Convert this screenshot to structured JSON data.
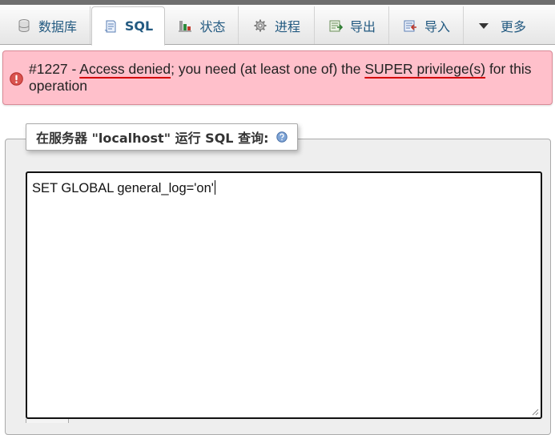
{
  "tabs": [
    {
      "label": "数据库",
      "icon": "database-icon",
      "active": false
    },
    {
      "label": "SQL",
      "icon": "sql-icon",
      "active": true
    },
    {
      "label": "状态",
      "icon": "status-chart-icon",
      "active": false
    },
    {
      "label": "进程",
      "icon": "gear-icon",
      "active": false
    },
    {
      "label": "导出",
      "icon": "export-icon",
      "active": false
    },
    {
      "label": "导入",
      "icon": "import-icon",
      "active": false
    },
    {
      "label": "更多",
      "icon": "chevron-down-icon",
      "active": false
    }
  ],
  "error": {
    "code": "#1227",
    "separator": " - ",
    "highlight_1": "Access denied",
    "text_1": "; you need (at least one of) the ",
    "highlight_2": "SUPER privilege(s)",
    "text_2": " for this operation",
    "icon": "error-icon"
  },
  "query_panel": {
    "legend": "在服务器 \"localhost\" 运行 SQL 查询:",
    "help_icon": "help-icon",
    "sql": "SET GLOBAL general_log='on'"
  },
  "colors": {
    "tab_text": "#235a81",
    "error_background": "#ffc0cb",
    "error_border": "#d98a96",
    "error_underline": "#d40000",
    "panel_background": "#eeeeee"
  }
}
